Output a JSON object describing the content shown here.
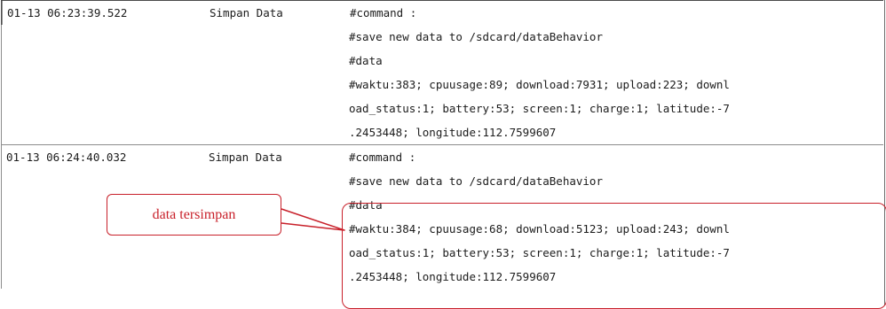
{
  "log": {
    "entries": [
      {
        "time": "01-13 06:23:39.522",
        "tag": "Simpan Data",
        "lines": [
          "#command :",
          "#save new data to /sdcard/dataBehavior",
          "#data",
          "#waktu:383; cpuusage:89; download:7931; upload:223; downl",
          "oad_status:1; battery:53; screen:1; charge:1; latitude:-7",
          ".2453448; longitude:112.7599607"
        ]
      },
      {
        "time": "01-13 06:24:40.032",
        "tag": "Simpan Data",
        "lines": [
          "#command :",
          "#save new data to /sdcard/dataBehavior",
          "#data",
          "#waktu:384; cpuusage:68; download:5123; upload:243; downl",
          "oad_status:1; battery:53; screen:1; charge:1; latitude:-7",
          ".2453448; longitude:112.7599607"
        ]
      }
    ]
  },
  "annotation": {
    "label": "data tersimpan",
    "color": "#c8202a"
  }
}
